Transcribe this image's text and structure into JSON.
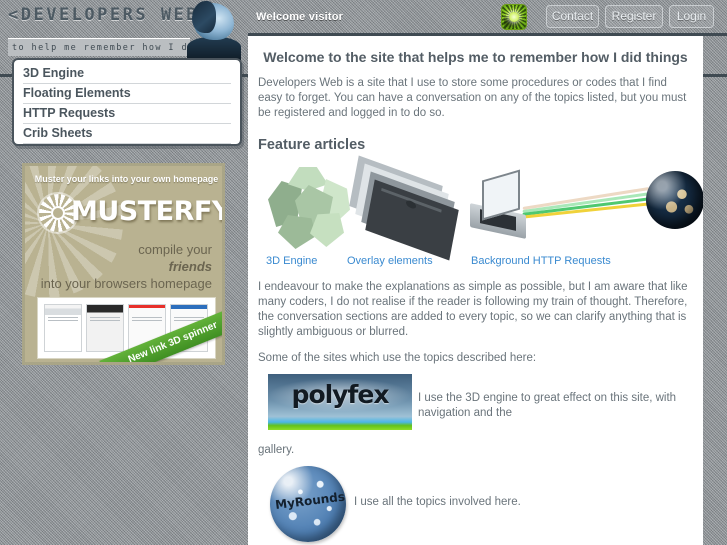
{
  "site": {
    "logo_title": "<DEVELOPERS WEB>",
    "tagline": "to help me remember how I did it",
    "portrait_alt": "author-portrait"
  },
  "topbar": {
    "welcome": "Welcome visitor",
    "brand_icon": "sunburst-spinner-icon",
    "buttons": [
      {
        "label": "Contact"
      },
      {
        "label": "Register"
      },
      {
        "label": "Login"
      }
    ]
  },
  "nav": {
    "items": [
      {
        "label": "3D Engine"
      },
      {
        "label": "Floating Elements"
      },
      {
        "label": "HTTP Requests"
      },
      {
        "label": "Crib Sheets"
      }
    ]
  },
  "banner": {
    "tagline_top": "Muster your links into your own homepage",
    "brand": "MUSTERFY",
    "line1": "compile your",
    "line2": "friends",
    "line3": "into your browsers homepage",
    "ribbon": "New link 3D spinner",
    "wheel_icon": "spoked-wheel-icon"
  },
  "main": {
    "heading": "Welcome to the site that helps me to remember how I did things",
    "intro": "Developers Web is a site that I use to store some procedures or codes that I find easy to forget. You can have a conversation on any of the topics listed, but you must be registered and logged in to do so.",
    "features_heading": "Feature articles",
    "features": [
      {
        "caption": "3D Engine",
        "icon": "dodecahedron-icon"
      },
      {
        "caption": "Overlay elements",
        "icon": "stacked-panes-icon"
      },
      {
        "caption": "Background HTTP Requests",
        "icon": "laptop-globe-icon"
      }
    ],
    "paragraph2": "I endeavour to make the explanations as simple as possible, but I am aware that like many coders, I do not realise if the reader is following my train of thought. Therefore, the conversation sections are added to every topic, so we can clarify anything that is slightly ambiguous or blurred.",
    "sites_intro": "Some of the sites which use the topics described here:",
    "sites": [
      {
        "logo_text": "polyfex",
        "description": "I use the 3D engine to great effect on this site, with navigation and the",
        "description_cont": "gallery."
      },
      {
        "logo_text": "MyRounds",
        "description": "I use all the topics involved here."
      }
    ]
  },
  "colors": {
    "accent_link": "#3a8ad0",
    "heading": "#535d65",
    "body_text": "#6a747b",
    "page_bg": "#8c9296",
    "rule": "#3f4a52",
    "ribbon_green": "#63b23a"
  }
}
